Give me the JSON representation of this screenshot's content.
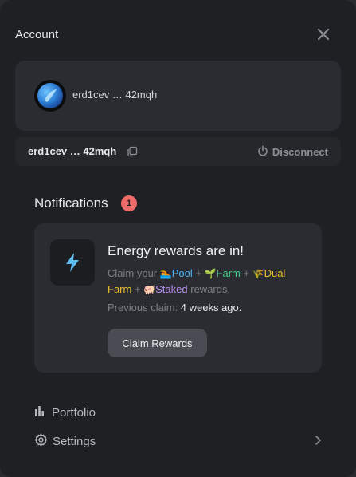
{
  "header": {
    "title": "Account",
    "close_icon": "close-icon"
  },
  "account": {
    "name": "erd1cev … 42mqh",
    "avatar_icon": "avatar-orb"
  },
  "address_bar": {
    "address": "erd1cev … 42mqh",
    "copy_icon": "copy-icon",
    "disconnect_label": "Disconnect",
    "disconnect_icon": "power-icon"
  },
  "notifications": {
    "title": "Notifications",
    "count": "1",
    "items": [
      {
        "icon": "lightning-icon",
        "headline": "Energy rewards are in!",
        "claim_prefix": "Claim your",
        "pool_label": "Pool",
        "plus1": "+",
        "farm_label": "Farm",
        "plus2": "+",
        "dual_farm_label": "Dual Farm",
        "plus3": "+",
        "staked_label": "Staked",
        "claim_suffix": "rewards.",
        "previous_label": "Previous claim:",
        "previous_value": "4 weeks ago.",
        "button_label": "Claim Rewards"
      }
    ]
  },
  "menu": {
    "portfolio_label": "Portfolio",
    "settings_label": "Settings"
  },
  "colors": {
    "pool": "#4fb3f0",
    "farm": "#4cc98a",
    "dual": "#e8c02c",
    "staked": "#b98ef0",
    "badge": "#f26b6b",
    "accent_energy": "#5bbcf0"
  }
}
